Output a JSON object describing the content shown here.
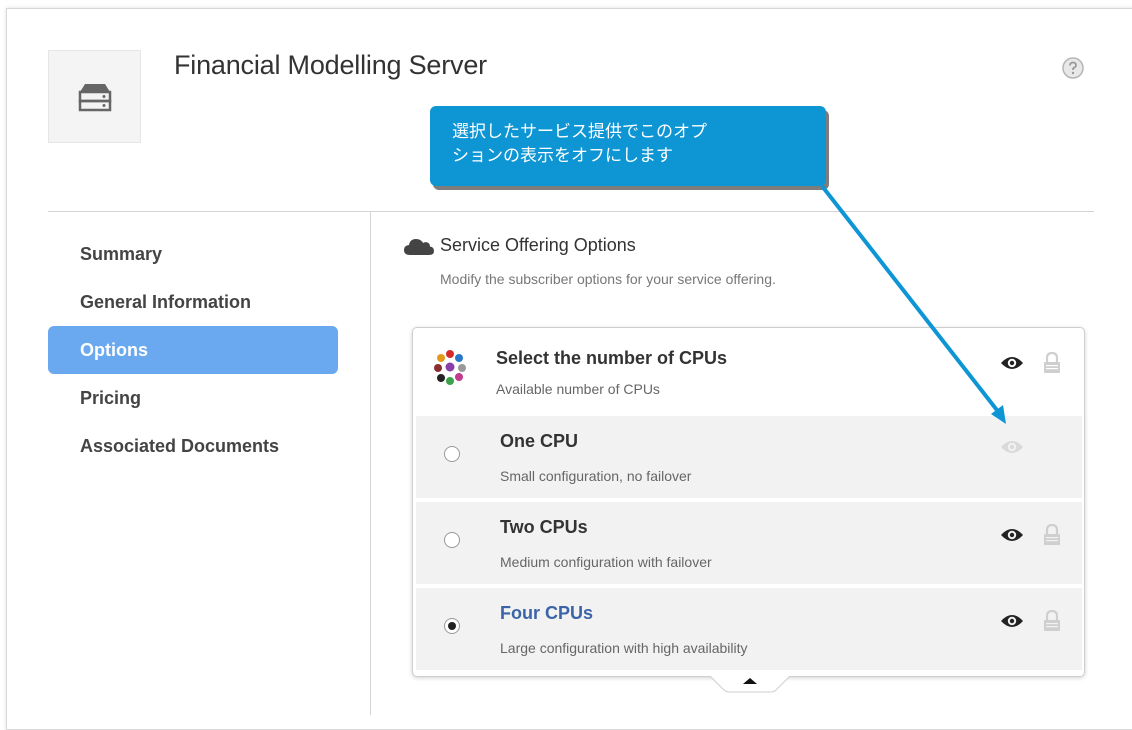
{
  "header": {
    "title": "Financial Modelling Server",
    "server_icon": "server-icon",
    "help_icon": "help-icon"
  },
  "sidebar": {
    "items": [
      {
        "label": "Summary",
        "active": false
      },
      {
        "label": "General Information",
        "active": false
      },
      {
        "label": "Options",
        "active": true
      },
      {
        "label": "Pricing",
        "active": false
      },
      {
        "label": "Associated Documents",
        "active": false
      }
    ]
  },
  "section": {
    "icon": "cloud-icon",
    "title": "Service Offering Options",
    "description": "Modify the subscriber options for your service offering."
  },
  "option_group": {
    "title": "Select the number of CPUs",
    "description": "Available number of CPUs",
    "icon": "molecule-icon",
    "options": [
      {
        "title": "One CPU",
        "description": "Small configuration, no failover",
        "selected": false,
        "visible": false
      },
      {
        "title": "Two CPUs",
        "description": "Medium configuration with failover",
        "selected": false,
        "visible": true
      },
      {
        "title": "Four CPUs",
        "description": "Large configuration with high availability",
        "selected": true,
        "visible": true
      }
    ]
  },
  "callout": {
    "line1": "選択したサービス提供でこのオプ",
    "line2": "ションの表示をオフにします"
  },
  "colors": {
    "accent": "#6aa8f0",
    "callout": "#0e95d4",
    "selected_option": "#3b64a8"
  }
}
